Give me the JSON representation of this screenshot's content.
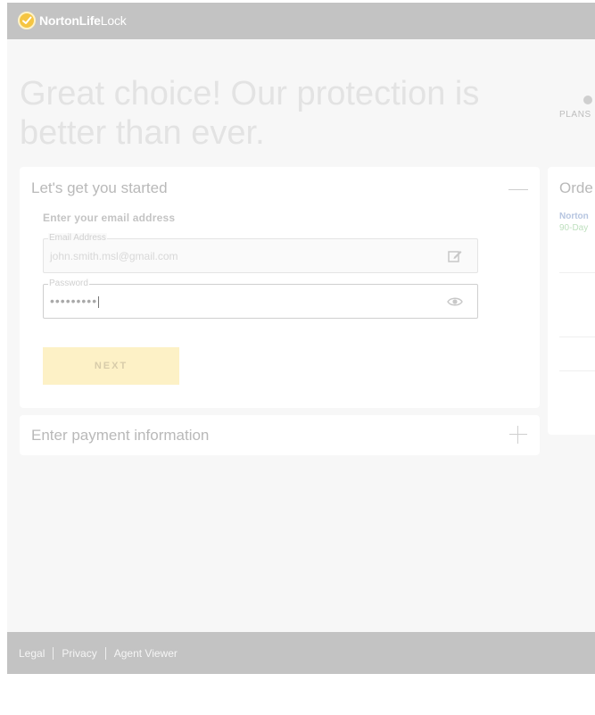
{
  "header": {
    "brand_main": "NortonLife",
    "brand_suffix": "Lock",
    "logo_icon": "checkmark-circle-icon"
  },
  "hero": {
    "headline": "Great choice! Our protection is better than ever."
  },
  "progress": {
    "step_label": "PLANS"
  },
  "start_section": {
    "title": "Let's get you started",
    "subtitle": "Enter your email address",
    "email": {
      "label": "Email Address",
      "value": "john.smith.msl@gmail.com",
      "icon": "edit-icon"
    },
    "password": {
      "label": "Password",
      "value": "•••••••••",
      "icon": "eye-icon"
    },
    "next_label": "NEXT"
  },
  "payment_section": {
    "title": "Enter payment information"
  },
  "order": {
    "title": "Orde",
    "product": "Norton",
    "trial": "90-Day"
  },
  "footer": {
    "links": [
      "Legal",
      "Privacy",
      "Agent Viewer"
    ]
  },
  "colors": {
    "header_bg": "#c3c3c3",
    "logo_accent": "#f5c542",
    "next_button_bg": "#fdf1c6"
  }
}
